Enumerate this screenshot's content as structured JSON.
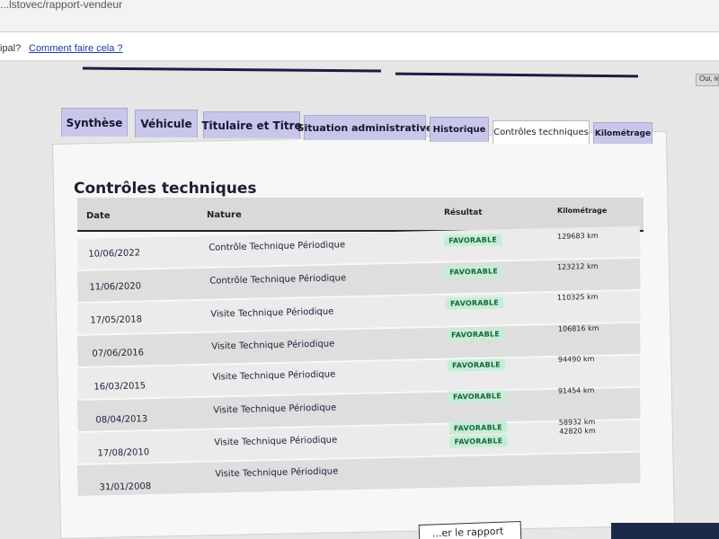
{
  "browser": {
    "url": "...lstovec/rapport-vendeur"
  },
  "help": {
    "question": "ipal?",
    "link": "Comment faire cela ?"
  },
  "oui_button": "Oui, le",
  "tabs": [
    {
      "label": "Synthèse",
      "active": false
    },
    {
      "label": "Véhicule",
      "active": false
    },
    {
      "label": "Titulaire et Titre",
      "active": false
    },
    {
      "label": "Situation administrative",
      "active": false
    },
    {
      "label": "Historique",
      "active": false
    },
    {
      "label": "Contrôles techniques",
      "active": true
    },
    {
      "label": "Kilométrage",
      "active": false
    }
  ],
  "section": {
    "title": "Contrôles techniques"
  },
  "table": {
    "headers": {
      "date": "Date",
      "nature": "Nature",
      "resultat": "Résultat",
      "kilometrage": "Kilométrage"
    },
    "rows": [
      {
        "date": "10/06/2022",
        "nature": "Contrôle Technique Périodique",
        "resultat": "FAVORABLE",
        "km": "129683 km"
      },
      {
        "date": "11/06/2020",
        "nature": "Contrôle Technique Périodique",
        "resultat": "FAVORABLE",
        "km": "123212 km"
      },
      {
        "date": "17/05/2018",
        "nature": "Visite Technique Périodique",
        "resultat": "FAVORABLE",
        "km": "110325 km"
      },
      {
        "date": "07/06/2016",
        "nature": "Visite Technique Périodique",
        "resultat": "FAVORABLE",
        "km": "106816 km"
      },
      {
        "date": "16/03/2015",
        "nature": "Visite Technique Périodique",
        "resultat": "FAVORABLE",
        "km": "94490 km"
      },
      {
        "date": "08/04/2013",
        "nature": "Visite Technique Périodique",
        "resultat": "FAVORABLE",
        "km": "91454 km"
      },
      {
        "date": "17/08/2010",
        "nature": "Visite Technique Périodique",
        "resultat": "FAVORABLE",
        "km": "58932 km"
      },
      {
        "date": "31/01/2008",
        "nature": "Visite Technique Périodique",
        "resultat": "FAVORABLE",
        "km": "42820 km"
      }
    ]
  },
  "footer": {
    "button": "...er le rapport"
  },
  "colors": {
    "tab_bg": "#c8c7ea",
    "badge_bg": "#c6eed6",
    "badge_text": "#16643e",
    "rule": "#1c1c44"
  }
}
